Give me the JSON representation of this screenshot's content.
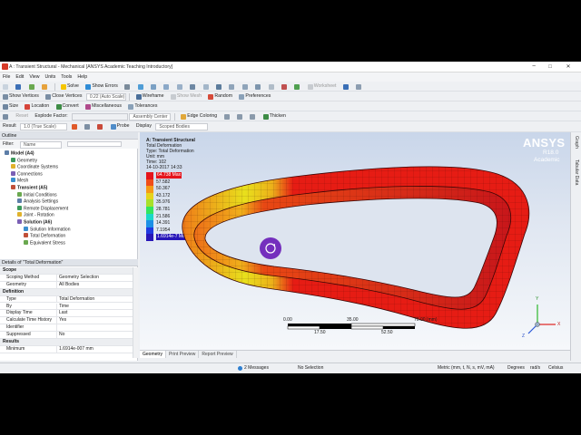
{
  "window": {
    "title": "A : Transient Structural - Mechanical [ANSYS Academic Teaching Introductory]",
    "minimize": "−",
    "maximize": "□",
    "close": "✕"
  },
  "menu": [
    "File",
    "Edit",
    "View",
    "Units",
    "Tools",
    "Help"
  ],
  "toolbar1": {
    "solve": "Solve",
    "show_errors": "Show Errors",
    "worksheet": "Worksheet"
  },
  "toolbar2": {
    "show_vertices": "Show Vertices",
    "close_vertices": "Close Vertices",
    "auto_scale": "0.22 (Auto Scale)",
    "wireframe": "Wireframe",
    "show_mesh": "Show Mesh",
    "random": "Random",
    "preferences": "Preferences"
  },
  "toolbar3": {
    "size": "Size",
    "location": "Location",
    "convert": "Convert",
    "miscellaneous": "Miscellaneous",
    "tolerances": "Tolerances"
  },
  "toolbar4": {
    "reset": "Reset",
    "explode_factor": "Explode Factor:",
    "assembly_center": "Assembly Center",
    "edge_coloring": "Edge Coloring",
    "thicken": "Thicken"
  },
  "toolbar5": {
    "result_label": "Result",
    "result_value": "1.0 (True Scale)",
    "probe": "Probe",
    "display_label": "Display",
    "display_value": "Scoped Bodies"
  },
  "outline": {
    "title": "Outline",
    "filter_label": "Filter:",
    "filter_value": "Name",
    "items": [
      {
        "label": "Model (A4)",
        "bold": true,
        "indent": 1
      },
      {
        "label": "Geometry",
        "bold": false,
        "indent": 2
      },
      {
        "label": "Coordinate Systems",
        "bold": false,
        "indent": 2
      },
      {
        "label": "Connections",
        "bold": false,
        "indent": 2
      },
      {
        "label": "Mesh",
        "bold": false,
        "indent": 2
      },
      {
        "label": "Transient (A5)",
        "bold": true,
        "indent": 2
      },
      {
        "label": "Initial Conditions",
        "bold": false,
        "indent": 3
      },
      {
        "label": "Analysis Settings",
        "bold": false,
        "indent": 3
      },
      {
        "label": "Remote Displacement",
        "bold": false,
        "indent": 3
      },
      {
        "label": "Joint - Rotation",
        "bold": false,
        "indent": 3
      },
      {
        "label": "Solution (A6)",
        "bold": true,
        "indent": 3
      },
      {
        "label": "Solution Information",
        "bold": false,
        "indent": 4
      },
      {
        "label": "Total Deformation",
        "bold": false,
        "indent": 4
      },
      {
        "label": "Equivalent Stress",
        "bold": false,
        "indent": 4
      }
    ]
  },
  "details": {
    "title": "Details of \"Total Deformation\"",
    "rows": [
      {
        "key": "Scope",
        "value": "",
        "section": true
      },
      {
        "key": "Scoping Method",
        "value": "Geometry Selection",
        "section": false
      },
      {
        "key": "Geometry",
        "value": "All Bodies",
        "section": false
      },
      {
        "key": "Definition",
        "value": "",
        "section": true
      },
      {
        "key": "Type",
        "value": "Total Deformation",
        "section": false
      },
      {
        "key": "By",
        "value": "Time",
        "section": false
      },
      {
        "key": "Display Time",
        "value": "Last",
        "section": false
      },
      {
        "key": "Calculate Time History",
        "value": "Yes",
        "section": false
      },
      {
        "key": "Identifier",
        "value": "",
        "section": false
      },
      {
        "key": "Suppressed",
        "value": "No",
        "section": false
      },
      {
        "key": "Results",
        "value": "",
        "section": true
      },
      {
        "key": "Minimum",
        "value": "1.6914e-007 mm",
        "section": false
      }
    ]
  },
  "viewport": {
    "result_title": "A: Transient Structural",
    "result_type": "Total Deformation",
    "type_line": "Type: Total Deformation",
    "unit_line": "Unit: mm",
    "time_line": "Time: 102",
    "date_line": "14-10-2017 14:33",
    "legend": [
      {
        "label": "64.738 Max",
        "color": "#e5141c"
      },
      {
        "label": "57.582",
        "color": "#f04d19"
      },
      {
        "label": "50.367",
        "color": "#f59a16"
      },
      {
        "label": "43.172",
        "color": "#e6d31c"
      },
      {
        "label": "35.976",
        "color": "#a8e02a"
      },
      {
        "label": "28.781",
        "color": "#33e55f"
      },
      {
        "label": "21.586",
        "color": "#1ad8c8"
      },
      {
        "label": "14.391",
        "color": "#1c8fe6"
      },
      {
        "label": "7.1954",
        "color": "#1f3ae0"
      },
      {
        "label": "1.6914e-7 Min",
        "color": "#2716b8"
      }
    ],
    "brand": "ANSYS",
    "version": "R18.0",
    "edition": "Academic",
    "scale": {
      "ticks_top": [
        "0.00",
        "35.00",
        "70.00 (mm)"
      ],
      "ticks_bottom": [
        "17.50",
        "52.50"
      ]
    },
    "axes": {
      "x": "X",
      "y": "Y",
      "z": "Z"
    }
  },
  "tabs": [
    "Geometry",
    "Print Preview",
    "Report Preview"
  ],
  "right_strip": [
    "Graph",
    "Tabular Data"
  ],
  "status": {
    "messages": "2 Messages",
    "selection": "No Selection",
    "units": "Metric (mm, t, N, s, mV, mA)",
    "angle": "Degrees",
    "rot": "rad/s",
    "temp": "Celsius"
  }
}
